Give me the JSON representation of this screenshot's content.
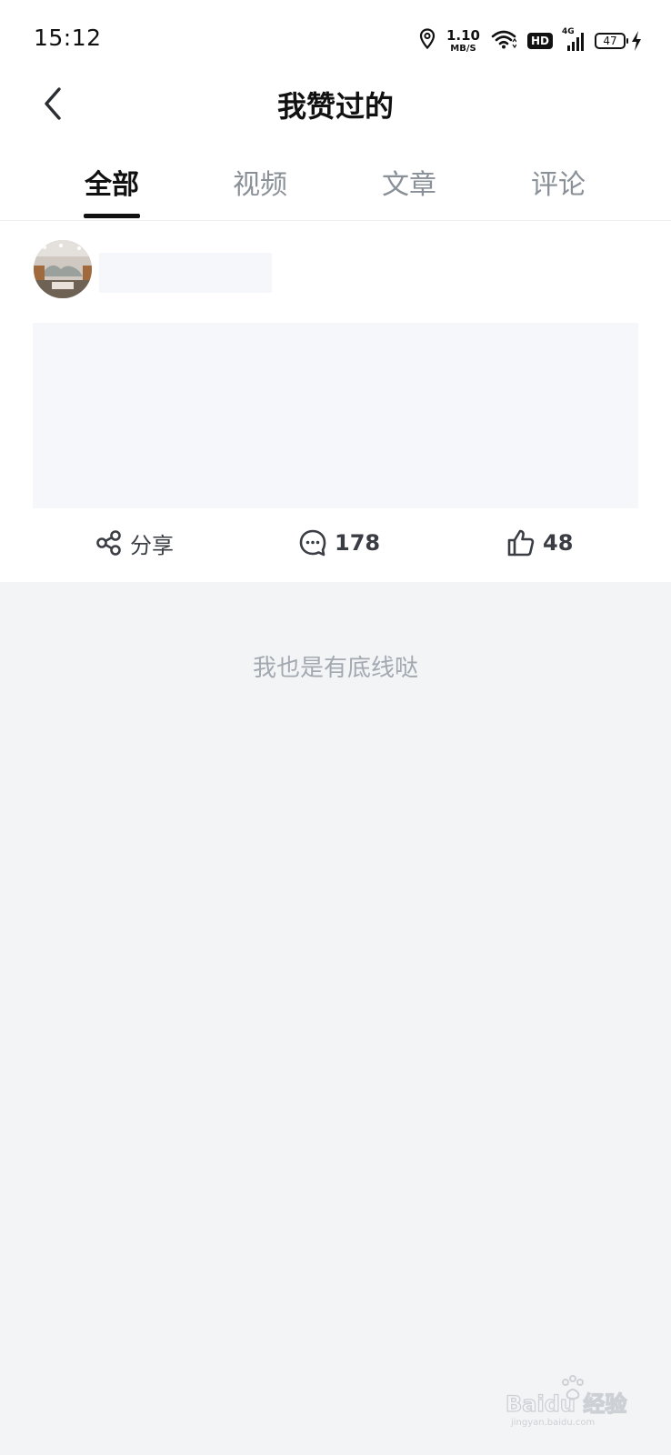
{
  "status_bar": {
    "time": "15:12",
    "net_speed_value": "1.10",
    "net_speed_unit": "MB/S",
    "hd_label": "HD",
    "network_label": "4G",
    "battery_level": "47"
  },
  "header": {
    "title": "我赞过的"
  },
  "tabs": [
    {
      "label": "全部",
      "active": true
    },
    {
      "label": "视频",
      "active": false
    },
    {
      "label": "文章",
      "active": false
    },
    {
      "label": "评论",
      "active": false
    }
  ],
  "post": {
    "actions": {
      "share_label": "分享",
      "comment_count": "178",
      "like_count": "48"
    }
  },
  "footer": {
    "end_text": "我也是有底线哒"
  },
  "watermark": {
    "text": "Baidu 经验",
    "subtext": "jingyan.baidu.com"
  },
  "colors": {
    "accent": "#111111",
    "inactive_tab": "#8a9097",
    "page_background": "#f3f4f6",
    "placeholder": "#f6f7fa",
    "end_text": "#a3a9b0"
  }
}
